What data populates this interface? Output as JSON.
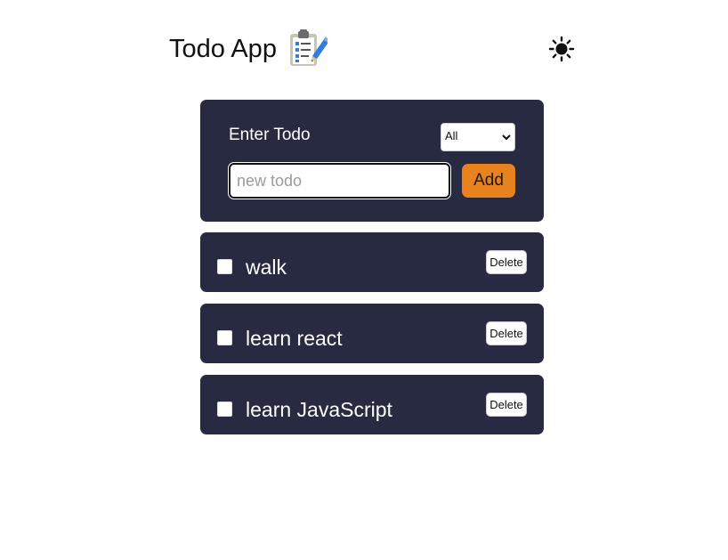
{
  "header": {
    "title": "Todo App",
    "title_icon": "clipboard-checklist-icon",
    "theme_toggle_icon": "sun-icon"
  },
  "form": {
    "label": "Enter Todo",
    "filter": {
      "selected": "All"
    },
    "input": {
      "value": "",
      "placeholder": "new todo"
    },
    "add_label": "Add"
  },
  "todos": [
    {
      "text": "walk",
      "completed": false,
      "delete_label": "Delete"
    },
    {
      "text": "learn react",
      "completed": false,
      "delete_label": "Delete"
    },
    {
      "text": "learn JavaScript",
      "completed": false,
      "delete_label": "Delete"
    }
  ],
  "colors": {
    "card_background": "#272a40",
    "accent": "#e8821f",
    "page_background": "#ffffff"
  }
}
